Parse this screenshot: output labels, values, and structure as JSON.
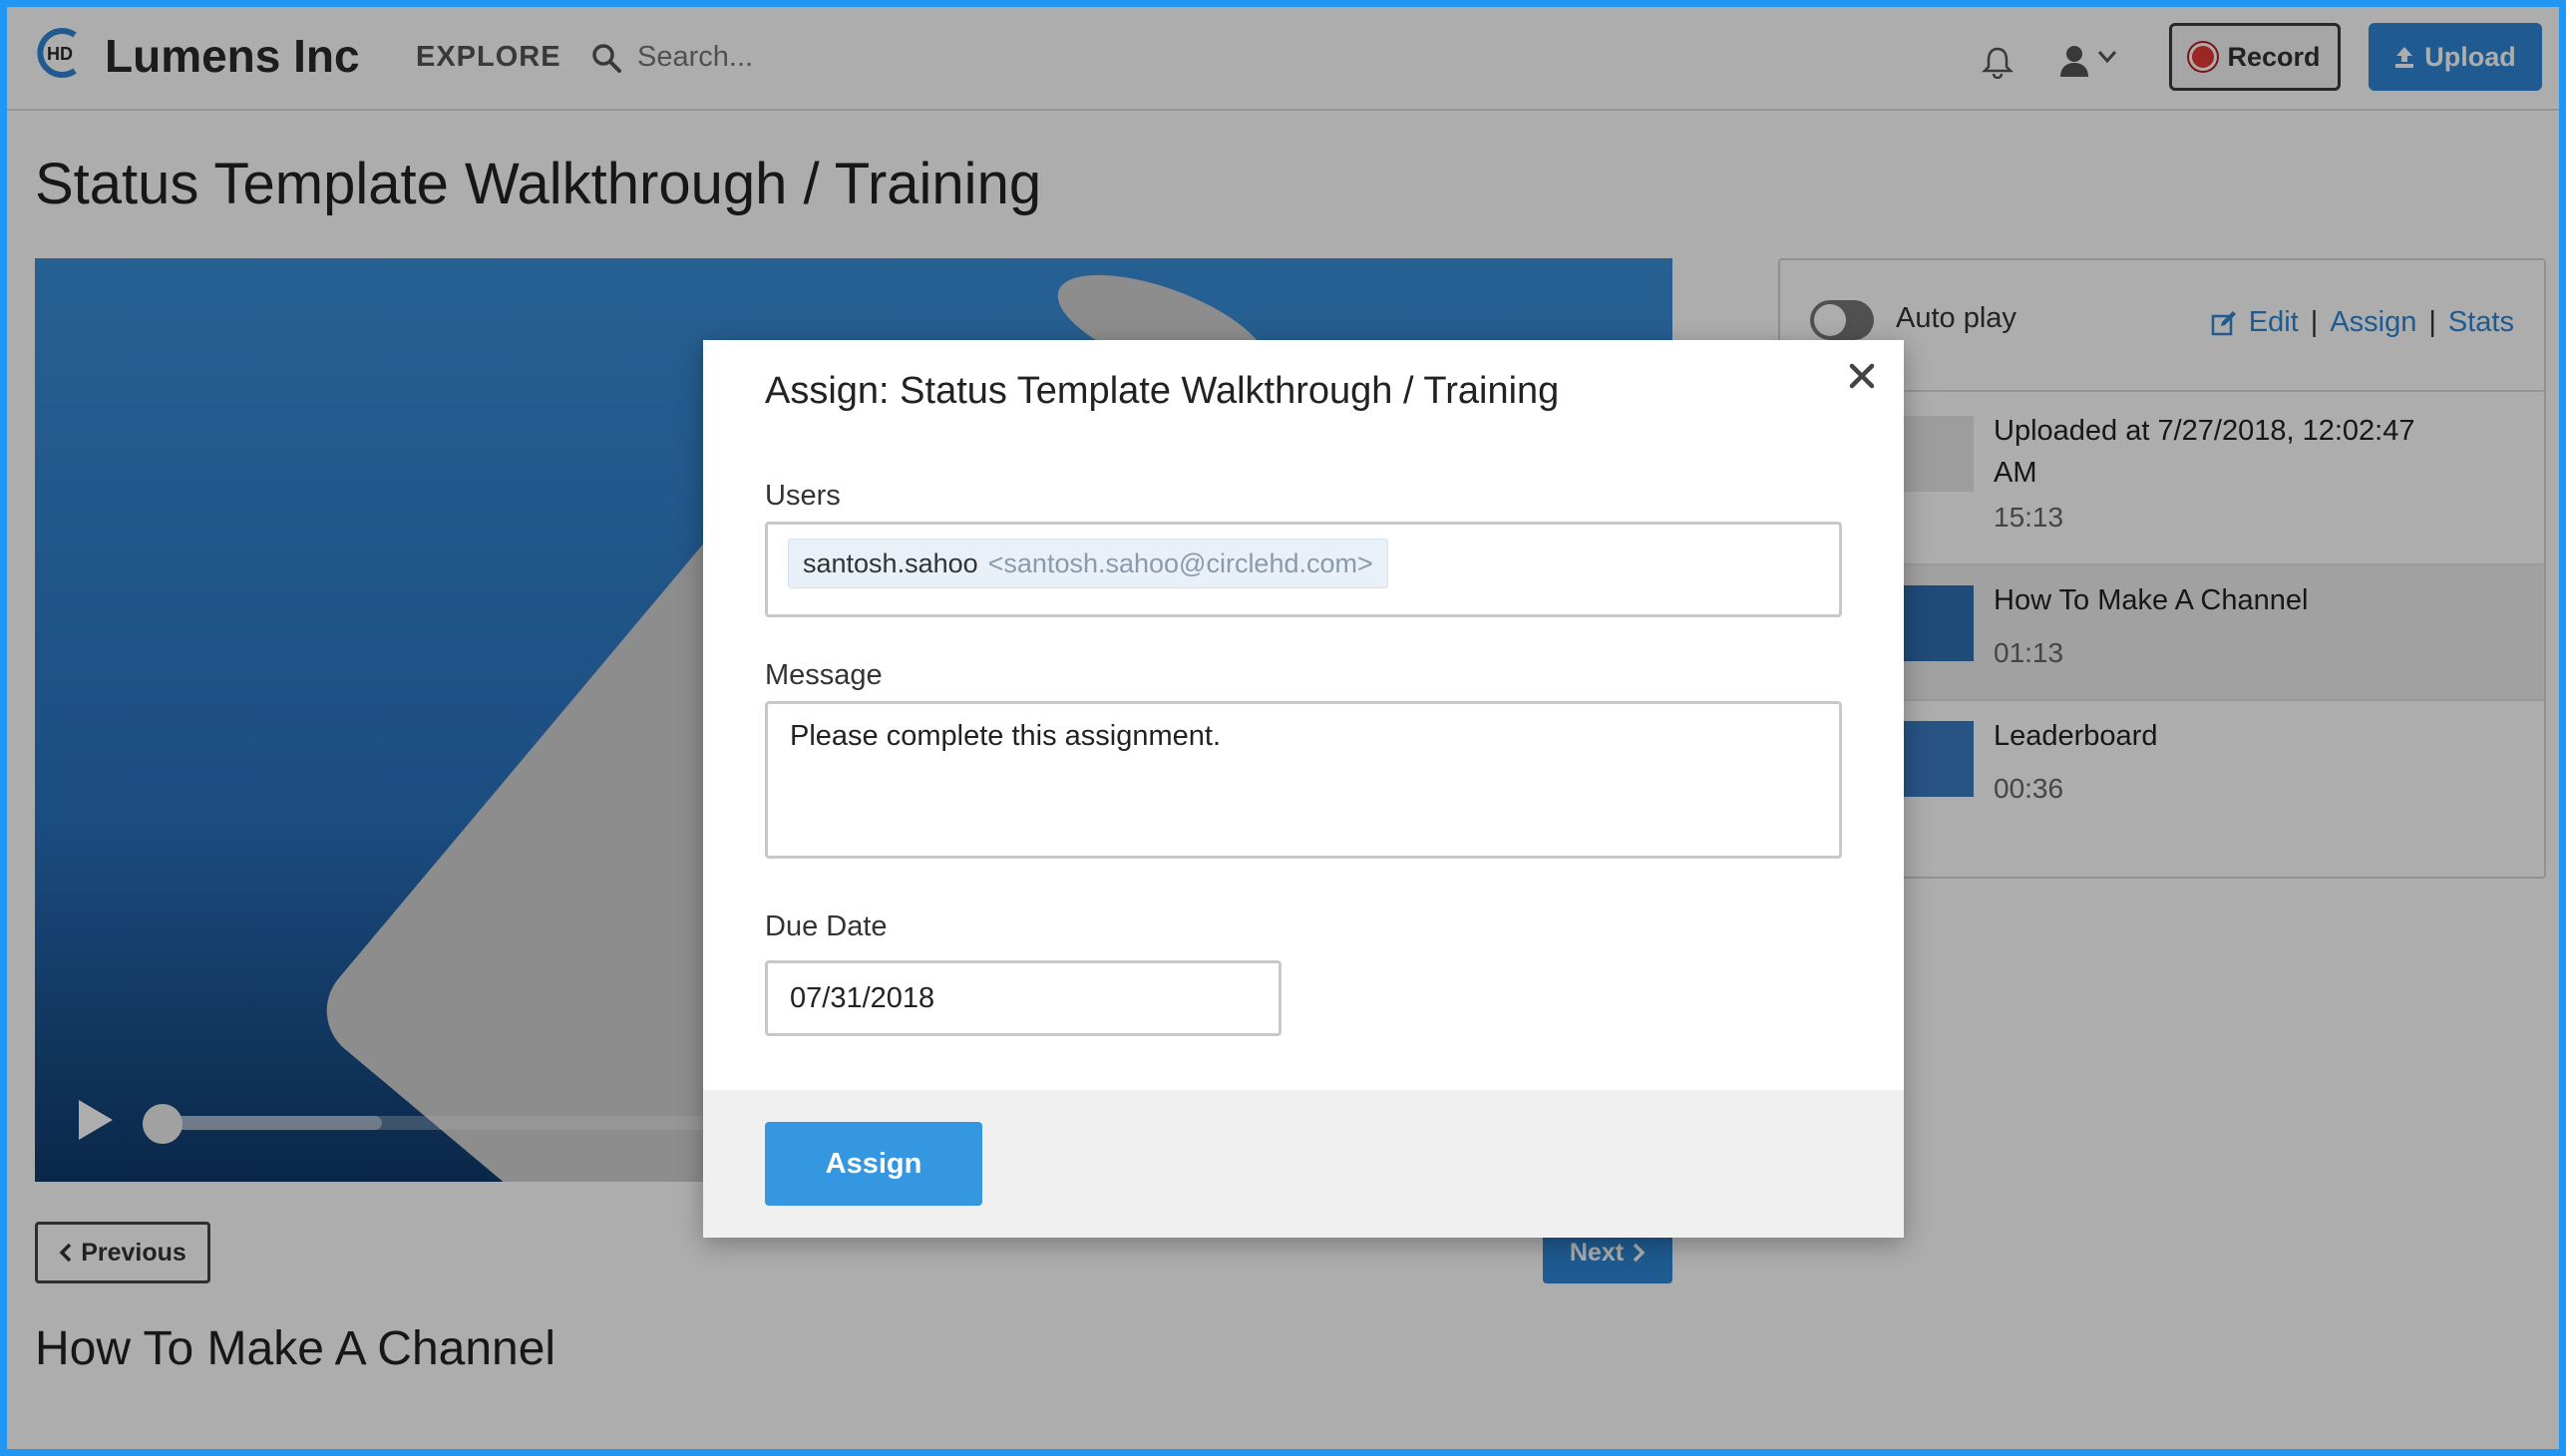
{
  "brand": {
    "name": "Lumens Inc",
    "logo_text": "HD"
  },
  "nav": {
    "explore_label": "EXPLORE",
    "search_placeholder": "Search...",
    "record_label": "Record",
    "upload_label": "Upload"
  },
  "page": {
    "title": "Status Template Walkthrough / Training",
    "prev_label": "Previous",
    "next_label": "Next",
    "next_video_title": "How To Make A Channel"
  },
  "video": {
    "progress_fraction": 0.0,
    "buffered_fraction": 0.22
  },
  "sidebar": {
    "autoplay_label": "Auto play",
    "autoplay_on": false,
    "links": {
      "edit": "Edit",
      "assign": "Assign",
      "stats": "Stats",
      "separator": "|"
    },
    "items": [
      {
        "title": "Uploaded at 7/27/2018, 12:02:47 AM",
        "time": "15:13",
        "highlighted": false
      },
      {
        "title": "How To Make A Channel",
        "time": "01:13",
        "highlighted": true
      },
      {
        "title": "Leaderboard",
        "time": "00:36",
        "highlighted": false
      }
    ]
  },
  "modal": {
    "title": "Assign: Status Template Walkthrough / Training",
    "users_label": "Users",
    "user_tag": {
      "name": "santosh.sahoo",
      "email": "<santosh.sahoo@circlehd.com>"
    },
    "message_label": "Message",
    "message_value": "Please complete this assignment.",
    "due_date_label": "Due Date",
    "due_date_value": "07/31/2018",
    "assign_button": "Assign"
  },
  "colors": {
    "accent": "#2e86d4",
    "assign_button": "#3597e0",
    "frame": "#2196f3",
    "record_dot": "#e53935"
  },
  "icons": [
    "logo-icon",
    "search-icon",
    "bell-icon",
    "user-icon",
    "chevron-down-icon",
    "record-dot-icon",
    "upload-icon",
    "play-icon",
    "chevron-left-icon",
    "chevron-right-icon",
    "edit-icon",
    "close-icon"
  ]
}
